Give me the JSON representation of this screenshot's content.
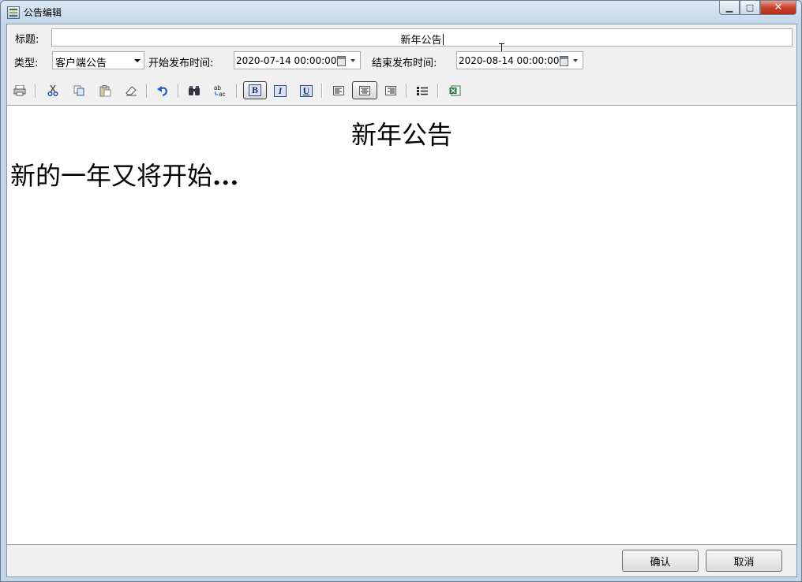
{
  "window": {
    "title": "公告编辑"
  },
  "form": {
    "title_label": "标题:",
    "title_value": "新年公告",
    "type_label": "类型:",
    "type_value": "客户端公告",
    "start_label": "开始发布时间:",
    "start_value": "2020-07-14 00:00:00",
    "end_label": "结束发布时间:",
    "end_value": "2020-08-14 00:00:00"
  },
  "toolbar": {
    "icons": [
      "print-icon",
      "cut-icon",
      "copy-icon",
      "paste-icon",
      "eraser-icon",
      "undo-icon",
      "find-icon",
      "replace-icon",
      "bold-icon",
      "italic-icon",
      "underline-icon",
      "align-left-icon",
      "align-center-icon",
      "align-right-icon",
      "bullet-list-icon",
      "excel-icon"
    ],
    "bold_label": "B",
    "italic_label": "I",
    "underline_label": "U",
    "active": [
      "bold",
      "align-center"
    ]
  },
  "editor": {
    "heading": "新年公告",
    "body_text": "新的一年又将开始",
    "body_ellipsis": "..."
  },
  "buttons": {
    "ok": "确认",
    "cancel": "取消"
  }
}
